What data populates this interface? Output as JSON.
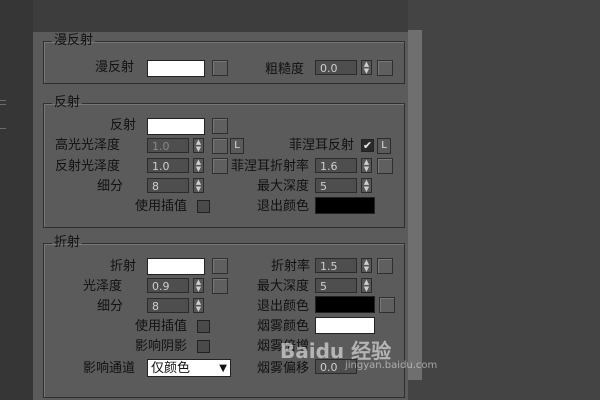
{
  "diffuse": {
    "title": "漫反射",
    "diffuse_label": "漫反射",
    "roughness_label": "粗糙度",
    "roughness_value": "0.0"
  },
  "reflection": {
    "title": "反射",
    "reflect_label": "反射",
    "hilight_gloss_label": "高光光泽度",
    "hilight_gloss_value": "1.0",
    "refl_gloss_label": "反射光泽度",
    "refl_gloss_value": "1.0",
    "subdivs_label": "细分",
    "subdivs_value": "8",
    "interp_label": "使用插值",
    "fresnel_label": "菲涅耳反射",
    "fresnel_ior_label": "菲涅耳折射率",
    "fresnel_ior_value": "1.6",
    "max_depth_label": "最大深度",
    "max_depth_value": "5",
    "exit_color_label": "退出颜色",
    "lock_label": "L",
    "fresnel_checked": true
  },
  "refraction": {
    "title": "折射",
    "refract_label": "折射",
    "gloss_label": "光泽度",
    "gloss_value": "0.9",
    "subdivs_label": "细分",
    "subdivs_value": "8",
    "interp_label": "使用插值",
    "shadows_label": "影响阴影",
    "channels_label": "影响通道",
    "channels_value": "仅颜色",
    "ior_label": "折射率",
    "ior_value": "1.5",
    "max_depth_label": "最大深度",
    "max_depth_value": "5",
    "exit_color_label": "退出颜色",
    "fog_color_label": "烟雾颜色",
    "fog_mult_label": "烟雾倍增",
    "fog_bias_label": "烟雾偏移",
    "fog_bias_value": "0.0"
  },
  "watermark": {
    "text": "Baidu 经验",
    "sub": "jingyan.baidu.com"
  },
  "colors": {
    "white_swatch": "#ffffff",
    "black_swatch": "#000000",
    "panel_bg": "#5b5b5b"
  }
}
